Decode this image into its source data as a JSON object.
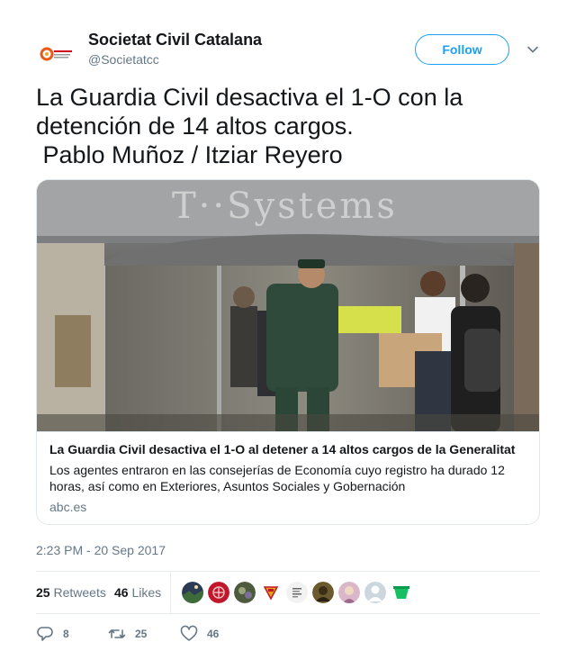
{
  "account": {
    "name": "Societat Civil Catalana",
    "handle": "@Societatcc",
    "avatar_icon": "scc-logo-icon"
  },
  "follow_label": "Follow",
  "menu_icon": "chevron-down-icon",
  "tweet": {
    "lines": [
      "La Guardia Civil desactiva el 1-O con la",
      "detención de 14 altos cargos.",
      " Pablo Muñoz / Itziar Reyero"
    ]
  },
  "card": {
    "image_sign_text": "T··Systems",
    "title": "La Guardia Civil desactiva el 1-O al detener a 14 altos cargos de la Generalitat",
    "description": "Los agentes entraron en las consejerías de Economía cuyo registro ha durado 12 horas, así como en Exteriores, Asuntos Sociales y Gobernación",
    "domain": "abc.es"
  },
  "timestamp": "2:23 PM - 20 Sep 2017",
  "stats": {
    "retweets_count": "25",
    "retweets_label": "Retweets",
    "likes_count": "46",
    "likes_label": "Likes"
  },
  "likers": [
    {
      "color": "#2b3a55",
      "icon": "avatar-night-sky"
    },
    {
      "color": "#c0182a",
      "icon": "avatar-red-emblem"
    },
    {
      "color": "#4d5a3e",
      "icon": "avatar-photo"
    },
    {
      "color": "#e0a21b",
      "icon": "avatar-spanish-flag"
    },
    {
      "color": "#f2f2f2",
      "icon": "avatar-text-logo"
    },
    {
      "color": "#6b5a2e",
      "icon": "avatar-photo-dark"
    },
    {
      "color": "#d9b7c9",
      "icon": "avatar-portrait"
    },
    {
      "color": "#ccd6dd",
      "icon": "avatar-default-egg"
    },
    {
      "color": "#17bf63",
      "icon": "avatar-green-logo"
    }
  ],
  "actions": {
    "reply_count": "8",
    "retweet_count": "25",
    "like_count": "46"
  },
  "colors": {
    "accent": "#1da1f2",
    "secondary_text": "#657786",
    "border": "#e1e8ed"
  }
}
